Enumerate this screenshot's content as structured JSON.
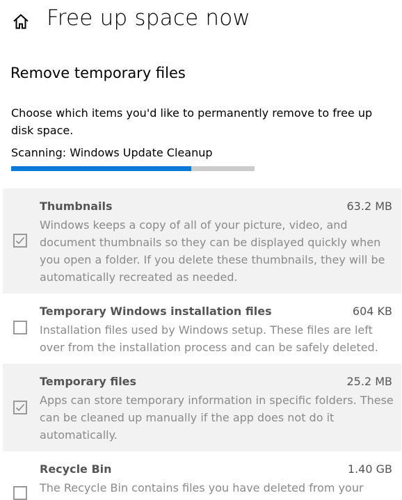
{
  "header": {
    "home_icon": "home-icon",
    "title": "Free up space now"
  },
  "section": {
    "title": "Remove temporary files",
    "description": "Choose which items you'd like to permanently remove to free up disk space.",
    "scan_status": "Scanning: Windows Update Cleanup",
    "scan_progress": 0.74
  },
  "items": [
    {
      "name": "Thumbnails",
      "size": "63.2 MB",
      "checked": true,
      "description": "Windows keeps a copy of all of your picture, video, and document thumbnails so they can be displayed quickly when you open a folder. If you delete these thumbnails, they will be automatically recreated as needed."
    },
    {
      "name": "Temporary Windows installation files",
      "size": "604 KB",
      "checked": false,
      "description": "Installation files used by Windows setup.  These files are left over from the installation process and can be safely deleted."
    },
    {
      "name": "Temporary files",
      "size": "25.2 MB",
      "checked": true,
      "description": "Apps can store temporary information in specific folders. These can be cleaned up manually if the app does not do it automatically."
    },
    {
      "name": "Recycle Bin",
      "size": "1.40 GB",
      "checked": false,
      "description": "The Recycle Bin contains files you have deleted from your"
    }
  ],
  "colors": {
    "accent": "#0a78d7",
    "track": "#cccccc",
    "row_shade": "#f2f2f2",
    "muted_text": "#8a8a8a"
  }
}
